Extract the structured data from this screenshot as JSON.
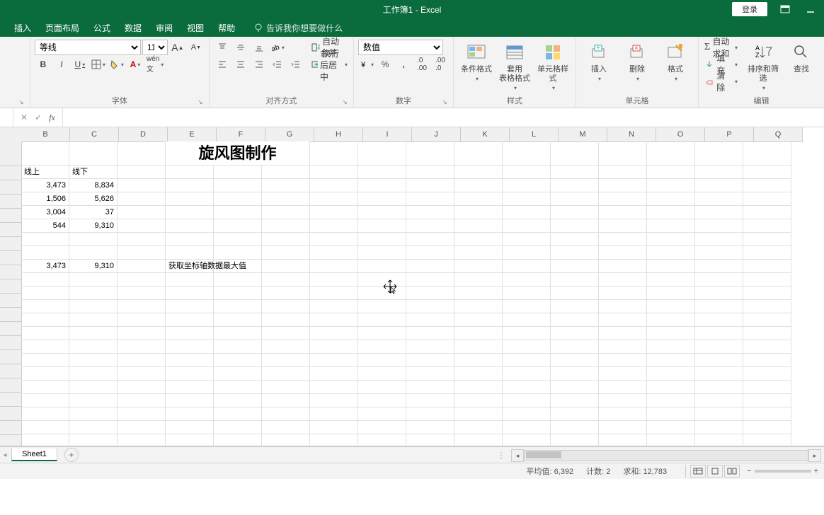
{
  "titlebar": {
    "title": "工作簿1 - Excel",
    "login": "登录"
  },
  "menubar": {
    "tabs": [
      "插入",
      "页面布局",
      "公式",
      "数据",
      "审阅",
      "视图",
      "帮助"
    ],
    "tell_me": "告诉我你想要做什么"
  },
  "ribbon": {
    "font": {
      "name": "等线",
      "size": "11",
      "incA": "A",
      "decA": "A",
      "bold": "B",
      "italic": "I",
      "underline": "U",
      "label": "字体"
    },
    "alignment": {
      "wrap": "自动换行",
      "merge": "合并后居中",
      "label": "对齐方式"
    },
    "number": {
      "format": "数值",
      "label": "数字"
    },
    "styles": {
      "cond": "条件格式",
      "table": "套用\n表格格式",
      "cell": "单元格样式",
      "label": "样式"
    },
    "cells": {
      "insert": "插入",
      "delete": "删除",
      "format": "格式",
      "label": "单元格"
    },
    "editing": {
      "autosum": "自动求和",
      "fill": "填充",
      "clear": "清除",
      "sort": "排序和筛选",
      "find": "查找",
      "label": "编辑"
    }
  },
  "formula_bar": {
    "fx": "fx",
    "value": ""
  },
  "columns": [
    "B",
    "C",
    "D",
    "E",
    "F",
    "G",
    "H",
    "I",
    "J",
    "K",
    "L",
    "M",
    "N",
    "O",
    "P",
    "Q"
  ],
  "rows_visible": 22,
  "sheet": {
    "title_cell": "旋风图制作",
    "headers": {
      "b": "线上",
      "c": "线下"
    },
    "data": [
      {
        "b": "3,473",
        "c": "8,834"
      },
      {
        "b": "1,506",
        "c": "5,626"
      },
      {
        "b": "3,004",
        "c": "37"
      },
      {
        "b": "544",
        "c": "9,310"
      }
    ],
    "max_row": {
      "b": "3,473",
      "c": "9,310",
      "label": "获取坐标轴数据最大值"
    }
  },
  "sheet_tabs": {
    "active": "Sheet1"
  },
  "statusbar": {
    "avg_label": "平均值:",
    "avg": "6,392",
    "count_label": "计数:",
    "count": "2",
    "sum_label": "求和:",
    "sum": "12,783",
    "zoom_minus": "−",
    "zoom_plus": "+"
  }
}
